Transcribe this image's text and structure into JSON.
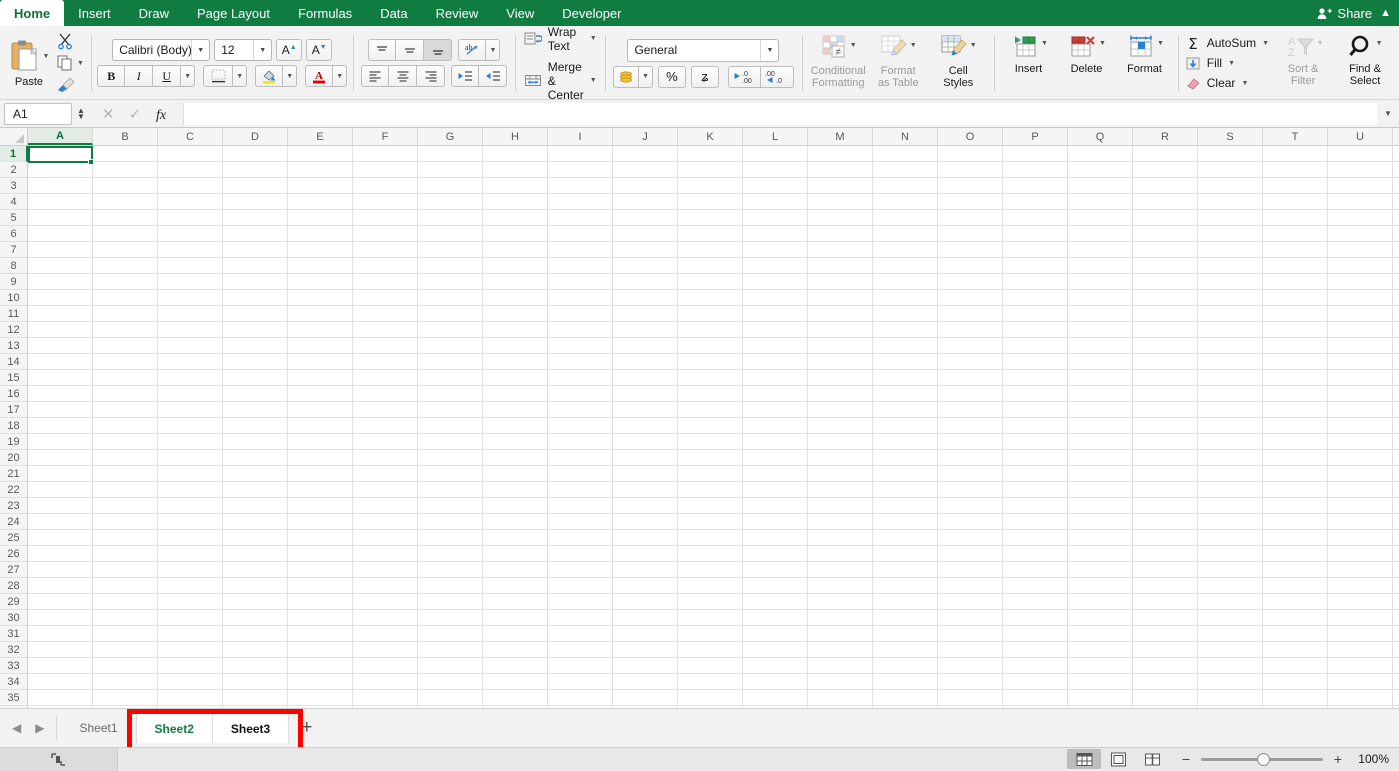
{
  "ribbon_tabs": [
    {
      "label": "Home",
      "active": true
    },
    {
      "label": "Insert",
      "active": false
    },
    {
      "label": "Draw",
      "active": false
    },
    {
      "label": "Page Layout",
      "active": false
    },
    {
      "label": "Formulas",
      "active": false
    },
    {
      "label": "Data",
      "active": false
    },
    {
      "label": "Review",
      "active": false
    },
    {
      "label": "View",
      "active": false
    },
    {
      "label": "Developer",
      "active": false
    }
  ],
  "share": {
    "label": "Share",
    "icon": "person-add-icon",
    "collapse_icon": "chevron-up-icon"
  },
  "clipboard": {
    "paste_label": "Paste",
    "cut_icon": "scissors-icon",
    "copy_icon": "copy-icon",
    "format_painter_icon": "paintbrush-icon"
  },
  "font": {
    "family_value": "Calibri (Body)",
    "size_value": "12",
    "grow_label": "A",
    "shrink_label": "A",
    "bold_label": "B",
    "italic_label": "I",
    "underline_label": "U",
    "borders_icon": "borders-icon",
    "fill_color_icon": "fill-color-icon",
    "font_color_icon": "font-color-icon"
  },
  "alignment": {
    "top_align_icon": "align-top-icon",
    "middle_align_icon": "align-middle-icon",
    "bottom_align_icon": "align-bottom-icon",
    "orientation_icon": "text-orientation-icon",
    "left_align_icon": "align-left-icon",
    "center_align_icon": "align-center-icon",
    "right_align_icon": "align-right-icon",
    "decrease_indent_icon": "decrease-indent-icon",
    "increase_indent_icon": "increase-indent-icon",
    "wrap_text_label": "Wrap Text",
    "merge_center_label": "Merge & Center"
  },
  "number": {
    "format_value": "General",
    "accounting_icon": "accounting-format-icon",
    "percent_label": "%",
    "comma_label": "ʑ",
    "increase_decimal_icon": "increase-decimal-icon",
    "decrease_decimal_icon": "decrease-decimal-icon"
  },
  "styles": [
    {
      "label": "Conditional\nFormatting",
      "line1": "Conditional",
      "line2": "Formatting",
      "dim": true,
      "icon": "conditional-formatting-icon"
    },
    {
      "label": "Format as Table",
      "line1": "Format",
      "line2": "as Table",
      "dim": true,
      "icon": "format-as-table-icon"
    },
    {
      "label": "Cell Styles",
      "line1": "Cell",
      "line2": "Styles",
      "dim": false,
      "icon": "cell-styles-icon"
    }
  ],
  "cells": [
    {
      "label": "Insert",
      "icon": "insert-cells-icon"
    },
    {
      "label": "Delete",
      "icon": "delete-cells-icon"
    },
    {
      "label": "Format",
      "icon": "format-cells-icon"
    }
  ],
  "editing": {
    "autosum_label": "AutoSum",
    "fill_label": "Fill",
    "clear_label": "Clear",
    "sort_filter_line1": "Sort &",
    "sort_filter_line2": "Filter",
    "find_select_line1": "Find &",
    "find_select_line2": "Select"
  },
  "formula_bar": {
    "name_box_value": "A1",
    "cancel_icon": "cancel-x-icon",
    "enter_icon": "confirm-check-icon",
    "fx_label": "fx",
    "input_value": "",
    "input_placeholder": "",
    "expand_icon": "chevron-down-icon"
  },
  "grid": {
    "columns": [
      "A",
      "B",
      "C",
      "D",
      "E",
      "F",
      "G",
      "H",
      "I",
      "J",
      "K",
      "L",
      "M",
      "N",
      "O",
      "P",
      "Q",
      "R",
      "S",
      "T",
      "U"
    ],
    "row_count": 36,
    "selected_cell": "A1",
    "selected_column": "A",
    "selected_row": 1
  },
  "sheet_tabs": {
    "prev_icon": "left-arrow-icon",
    "next_icon": "right-arrow-icon",
    "tabs": [
      {
        "label": "Sheet1",
        "state": "inactive"
      },
      {
        "label": "Sheet2",
        "state": "active"
      },
      {
        "label": "Sheet3",
        "state": "selected-bold"
      }
    ],
    "add_label": "+",
    "highlight_color": "#fe0000"
  },
  "status_bar": {
    "accessibility_icon": "accessibility-icon",
    "normal_view_icon": "normal-view-icon",
    "page_layout_icon": "page-layout-icon",
    "page_break_icon": "page-break-icon",
    "zoom_out_label": "−",
    "zoom_in_label": "+",
    "zoom_value": "100%"
  },
  "colors": {
    "excel_green": "#107C41",
    "tab_text_green": "#0e7138",
    "highlight_red": "#fe0000"
  }
}
